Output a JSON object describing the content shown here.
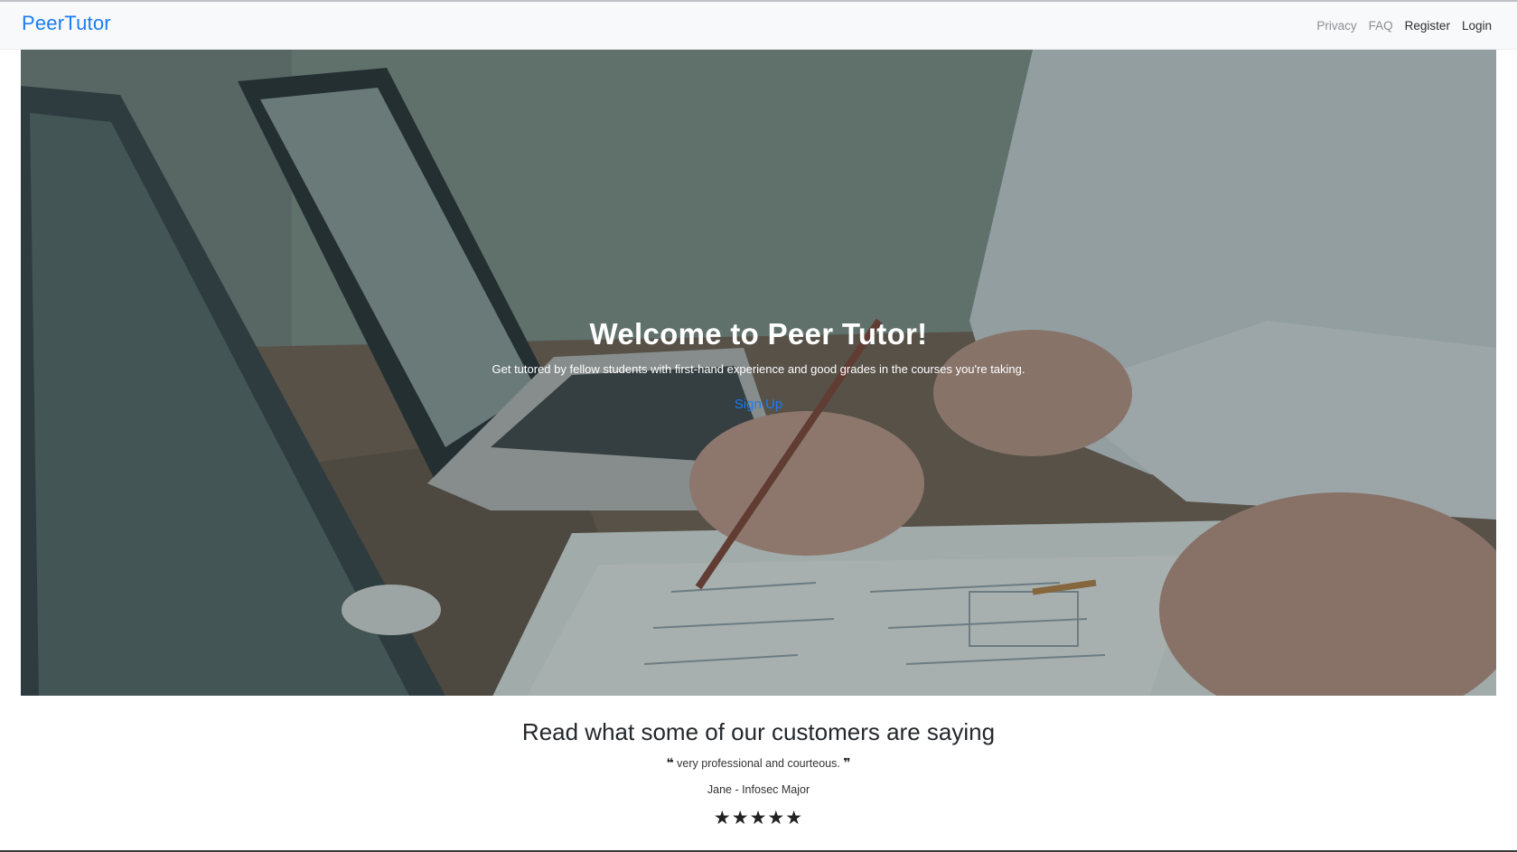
{
  "navbar": {
    "brand": "PeerTutor",
    "links": {
      "privacy": "Privacy",
      "faq": "FAQ",
      "register": "Register",
      "login": "Login"
    }
  },
  "hero": {
    "title": "Welcome to Peer Tutor!",
    "subtitle": "Get tutored by fellow students with first-hand experience and good grades in the courses you're taking.",
    "cta": "Sign Up"
  },
  "testimonials": {
    "heading": "Read what some of our customers are saying",
    "quote_open": "❝",
    "quote": "very professional and courteous.",
    "quote_close": "❞",
    "author": "Jane - Infosec Major",
    "rating": 5,
    "stars": "★★★★★"
  },
  "colors": {
    "brand": "#1a7cf3",
    "navbar_bg": "#f8f9fa"
  }
}
